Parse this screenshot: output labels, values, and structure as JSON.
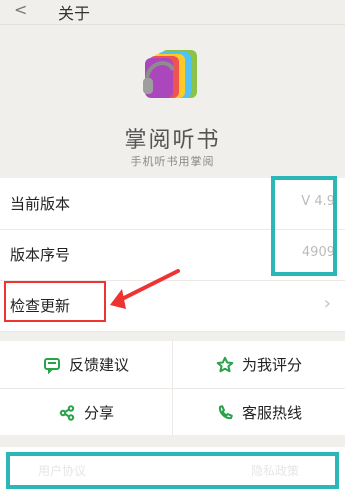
{
  "header": {
    "back_glyph": "<",
    "title": "关于"
  },
  "app": {
    "name": "掌阅听书",
    "slogan": "手机听书用掌阅"
  },
  "list": {
    "items": [
      {
        "label": "当前版本",
        "value": "V 4.9"
      },
      {
        "label": "版本序号",
        "value": "4909"
      },
      {
        "label": "检查更新",
        "value": ""
      }
    ]
  },
  "actions": {
    "feedback": "反馈建议",
    "rate": "为我评分",
    "share": "分享",
    "hotline": "客服热线"
  },
  "bottom": {
    "left": "用户协议",
    "right": "隐私政策"
  },
  "colors": {
    "accent_green": "#2aa24a",
    "highlight_cyan": "#2bb7b7",
    "highlight_red": "#e33333"
  },
  "icons": [
    "back-icon",
    "app-logo-icon",
    "chevron-right-icon",
    "message-icon",
    "star-icon",
    "share-icon",
    "phone-icon"
  ]
}
